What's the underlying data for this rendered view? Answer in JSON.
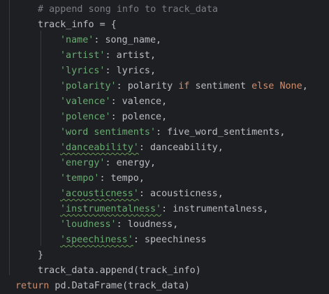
{
  "editor": {
    "colors": {
      "background": "#1e1f22",
      "comment": "#7a7e85",
      "string": "#6aab73",
      "keyword": "#cf8e6d",
      "default": "#bcbec4"
    },
    "lines": [
      {
        "indent": 4,
        "tokens": [
          {
            "type": "comment",
            "text": "# append song info to track_data"
          }
        ]
      },
      {
        "indent": 4,
        "tokens": [
          {
            "type": "default",
            "text": "track_info = {"
          }
        ]
      },
      {
        "indent": 8,
        "tokens": [
          {
            "type": "string",
            "text": "'name'"
          },
          {
            "type": "default",
            "text": ": song_name,"
          }
        ]
      },
      {
        "indent": 8,
        "tokens": [
          {
            "type": "string",
            "text": "'artist'"
          },
          {
            "type": "default",
            "text": ": artist,"
          }
        ]
      },
      {
        "indent": 8,
        "tokens": [
          {
            "type": "string",
            "text": "'lyrics'"
          },
          {
            "type": "default",
            "text": ": lyrics,"
          }
        ]
      },
      {
        "indent": 8,
        "tokens": [
          {
            "type": "string",
            "text": "'polarity'"
          },
          {
            "type": "default",
            "text": ": polarity "
          },
          {
            "type": "keyword",
            "text": "if"
          },
          {
            "type": "default",
            "text": " sentiment "
          },
          {
            "type": "keyword",
            "text": "else"
          },
          {
            "type": "default",
            "text": " "
          },
          {
            "type": "keyword",
            "text": "None"
          },
          {
            "type": "default",
            "text": ","
          }
        ]
      },
      {
        "indent": 8,
        "tokens": [
          {
            "type": "string",
            "text": "'valence'"
          },
          {
            "type": "default",
            "text": ": valence,"
          }
        ]
      },
      {
        "indent": 8,
        "tokens": [
          {
            "type": "string",
            "text": "'polence'"
          },
          {
            "type": "default",
            "text": ": polence,"
          }
        ]
      },
      {
        "indent": 8,
        "tokens": [
          {
            "type": "string",
            "text": "'word sentiments'"
          },
          {
            "type": "default",
            "text": ": five_word_sentiments,"
          }
        ]
      },
      {
        "indent": 8,
        "tokens": [
          {
            "type": "string",
            "text": "'danceability'",
            "squiggle": true
          },
          {
            "type": "default",
            "text": ": danceability,"
          }
        ]
      },
      {
        "indent": 8,
        "tokens": [
          {
            "type": "string",
            "text": "'energy'"
          },
          {
            "type": "default",
            "text": ": energy,"
          }
        ]
      },
      {
        "indent": 8,
        "tokens": [
          {
            "type": "string",
            "text": "'tempo'"
          },
          {
            "type": "default",
            "text": ": tempo,"
          }
        ]
      },
      {
        "indent": 8,
        "tokens": [
          {
            "type": "string",
            "text": "'acousticness'",
            "squiggle": true
          },
          {
            "type": "default",
            "text": ": acousticness,"
          }
        ]
      },
      {
        "indent": 8,
        "tokens": [
          {
            "type": "string",
            "text": "'instrumentalness'",
            "squiggle": true
          },
          {
            "type": "default",
            "text": ": instrumentalness,"
          }
        ]
      },
      {
        "indent": 8,
        "tokens": [
          {
            "type": "string",
            "text": "'loudness'"
          },
          {
            "type": "default",
            "text": ": loudness,"
          }
        ]
      },
      {
        "indent": 8,
        "tokens": [
          {
            "type": "string",
            "text": "'speechiness'",
            "squiggle": true
          },
          {
            "type": "default",
            "text": ": speechiness"
          }
        ]
      },
      {
        "indent": 4,
        "tokens": [
          {
            "type": "default",
            "text": "}"
          }
        ]
      },
      {
        "indent": 4,
        "tokens": [
          {
            "type": "default",
            "text": "track_data.append(track_info)"
          }
        ]
      },
      {
        "indent": 0,
        "tokens": [
          {
            "type": "keyword",
            "text": "return"
          },
          {
            "type": "default",
            "text": " pd.DataFrame(track_data)"
          }
        ]
      }
    ]
  }
}
